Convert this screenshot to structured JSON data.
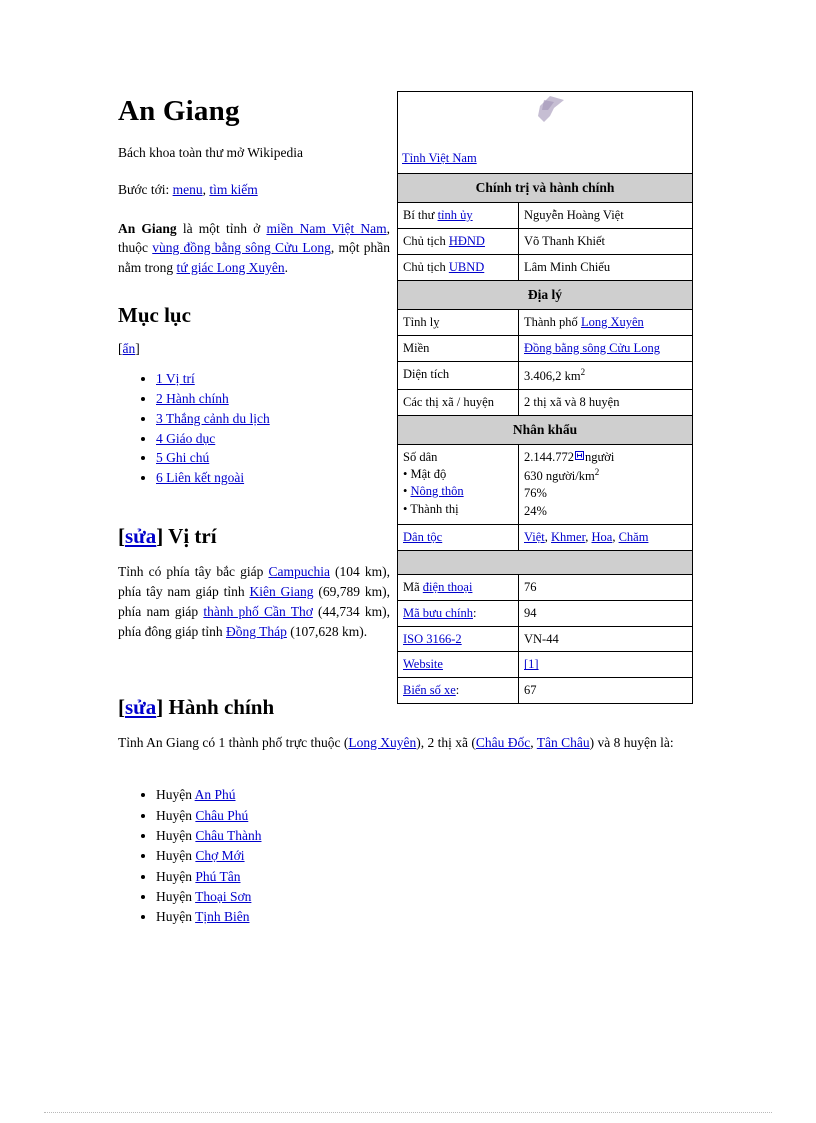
{
  "article": {
    "title": "An Giang",
    "tagline": "Bách khoa toàn thư mở Wikipedia",
    "jumpto_label": "Bước tới:",
    "jumpto_links": [
      "menu",
      "tìm kiếm"
    ],
    "jumpto_separator": ",",
    "lead": {
      "bold_name": "An Giang",
      "t1": " là một tỉnh ở ",
      "l1": "miền Nam Việt Nam",
      "t2": ", thuộc ",
      "l2": "vùng đồng bằng sông Cửu Long",
      "t3": ", một phần nằm trong ",
      "l3": "tứ giác Long Xuyên",
      "t4": "."
    }
  },
  "toc": {
    "heading": "Mục lục",
    "hide_open": "[",
    "hide_label": "ẩn",
    "hide_close": "]",
    "items": [
      "1 Vị trí",
      "2 Hành chính",
      "3 Thắng cảnh du lịch",
      "4 Giáo dục",
      "5 Ghi chú",
      "6 Liên kết ngoài"
    ]
  },
  "sections": {
    "edit_open": "[",
    "edit_label": "sửa",
    "edit_close": "]",
    "vitri": {
      "heading": "Vị trí",
      "t1": "Tỉnh có phía tây bắc giáp ",
      "l1": "Campuchia",
      "t2": " (104 km), phía tây nam giáp tỉnh ",
      "l2": "Kiên Giang",
      "t3": " (69,789 km), phía nam giáp ",
      "l3": "thành phố Cần Thơ",
      "t4": " (44,734 km), phía đông giáp tỉnh ",
      "l4": "Đồng Tháp",
      "t5": " (107,628 km)."
    },
    "hanhchinh": {
      "heading": "Hành chính",
      "t1": "Tỉnh An Giang có 1 thành phố trực thuộc (",
      "l1": "Long Xuyên",
      "t2": "), 2 thị xã (",
      "l2": "Châu Đốc",
      "t3": ", ",
      "l3": "Tân Châu",
      "t4": ") và 8 huyện là:",
      "district_prefix": "Huyện ",
      "districts": [
        "An Phú",
        "Châu Phú",
        "Châu Thành",
        "Chợ Mới",
        "Phú Tân",
        "Thoại Sơn",
        "Tịnh Biên"
      ]
    }
  },
  "infobox": {
    "map_caption": "Tỉnh Việt Nam",
    "header_politics": "Chính trị và hành chính",
    "header_geography": "Địa lý",
    "header_demographics": "Nhân khẩu",
    "header_blank": "",
    "rows_politics": [
      {
        "label_text": "Bí thư ",
        "label_link": "tỉnh ủy",
        "value": "Nguyễn Hoàng Việt"
      },
      {
        "label_text": "Chủ tịch ",
        "label_link": "HĐND",
        "value": "Võ Thanh Khiết"
      },
      {
        "label_text": "Chủ tịch ",
        "label_link": "UBND",
        "value": "Lâm Minh Chiếu"
      }
    ],
    "geography": {
      "tinh_ly_label": "Tỉnh lỵ",
      "tinh_ly_prefix": "Thành phố ",
      "tinh_ly_link": "Long Xuyên",
      "mien_label": "Miền",
      "mien_link": "Đồng bằng sông Cửu Long",
      "dien_tich_label": "Diện tích",
      "dien_tich_value": "3.406,2 km",
      "dien_tich_sup": "2",
      "thixa_label": "Các thị xã / huyện",
      "thixa_value": "2 thị xã và 8 huyện"
    },
    "demographics": {
      "so_dan_label": "Số dân",
      "so_dan_value": "2.144.772",
      "so_dan_unit": "người",
      "mat_do_label": "Mật độ",
      "mat_do_value": "630 người/km",
      "mat_do_sup": "2",
      "nong_thon_label": "Nông thôn",
      "nong_thon_value": "76%",
      "thanh_thi_label": "Thành thị",
      "thanh_thi_value": "24%",
      "dan_toc_label": "Dân tộc",
      "dan_toc_values": [
        "Việt",
        "Khmer",
        "Hoa",
        "Chăm"
      ],
      "dan_toc_separator": ", "
    },
    "codes": [
      {
        "label_text": "Mã ",
        "label_link": "điện thoại",
        "label_suffix": "",
        "value": "76",
        "value_is_link": false
      },
      {
        "label_text": "",
        "label_link": "Mã bưu chính",
        "label_suffix": ":",
        "value": "94",
        "value_is_link": false
      },
      {
        "label_text": "",
        "label_link": "ISO 3166-2",
        "label_suffix": "",
        "value": "VN-44",
        "value_is_link": false
      },
      {
        "label_text": "",
        "label_link": "Website",
        "label_suffix": "",
        "value": "[1]",
        "value_is_link": true
      },
      {
        "label_text": "",
        "label_link": "Biển số xe",
        "label_suffix": ":",
        "value": "67",
        "value_is_link": false
      }
    ]
  },
  "colors": {
    "link": "#0000cc",
    "header_bg": "#cfcfcf",
    "border": "#000000",
    "map_shape": "#b3a8c4"
  }
}
